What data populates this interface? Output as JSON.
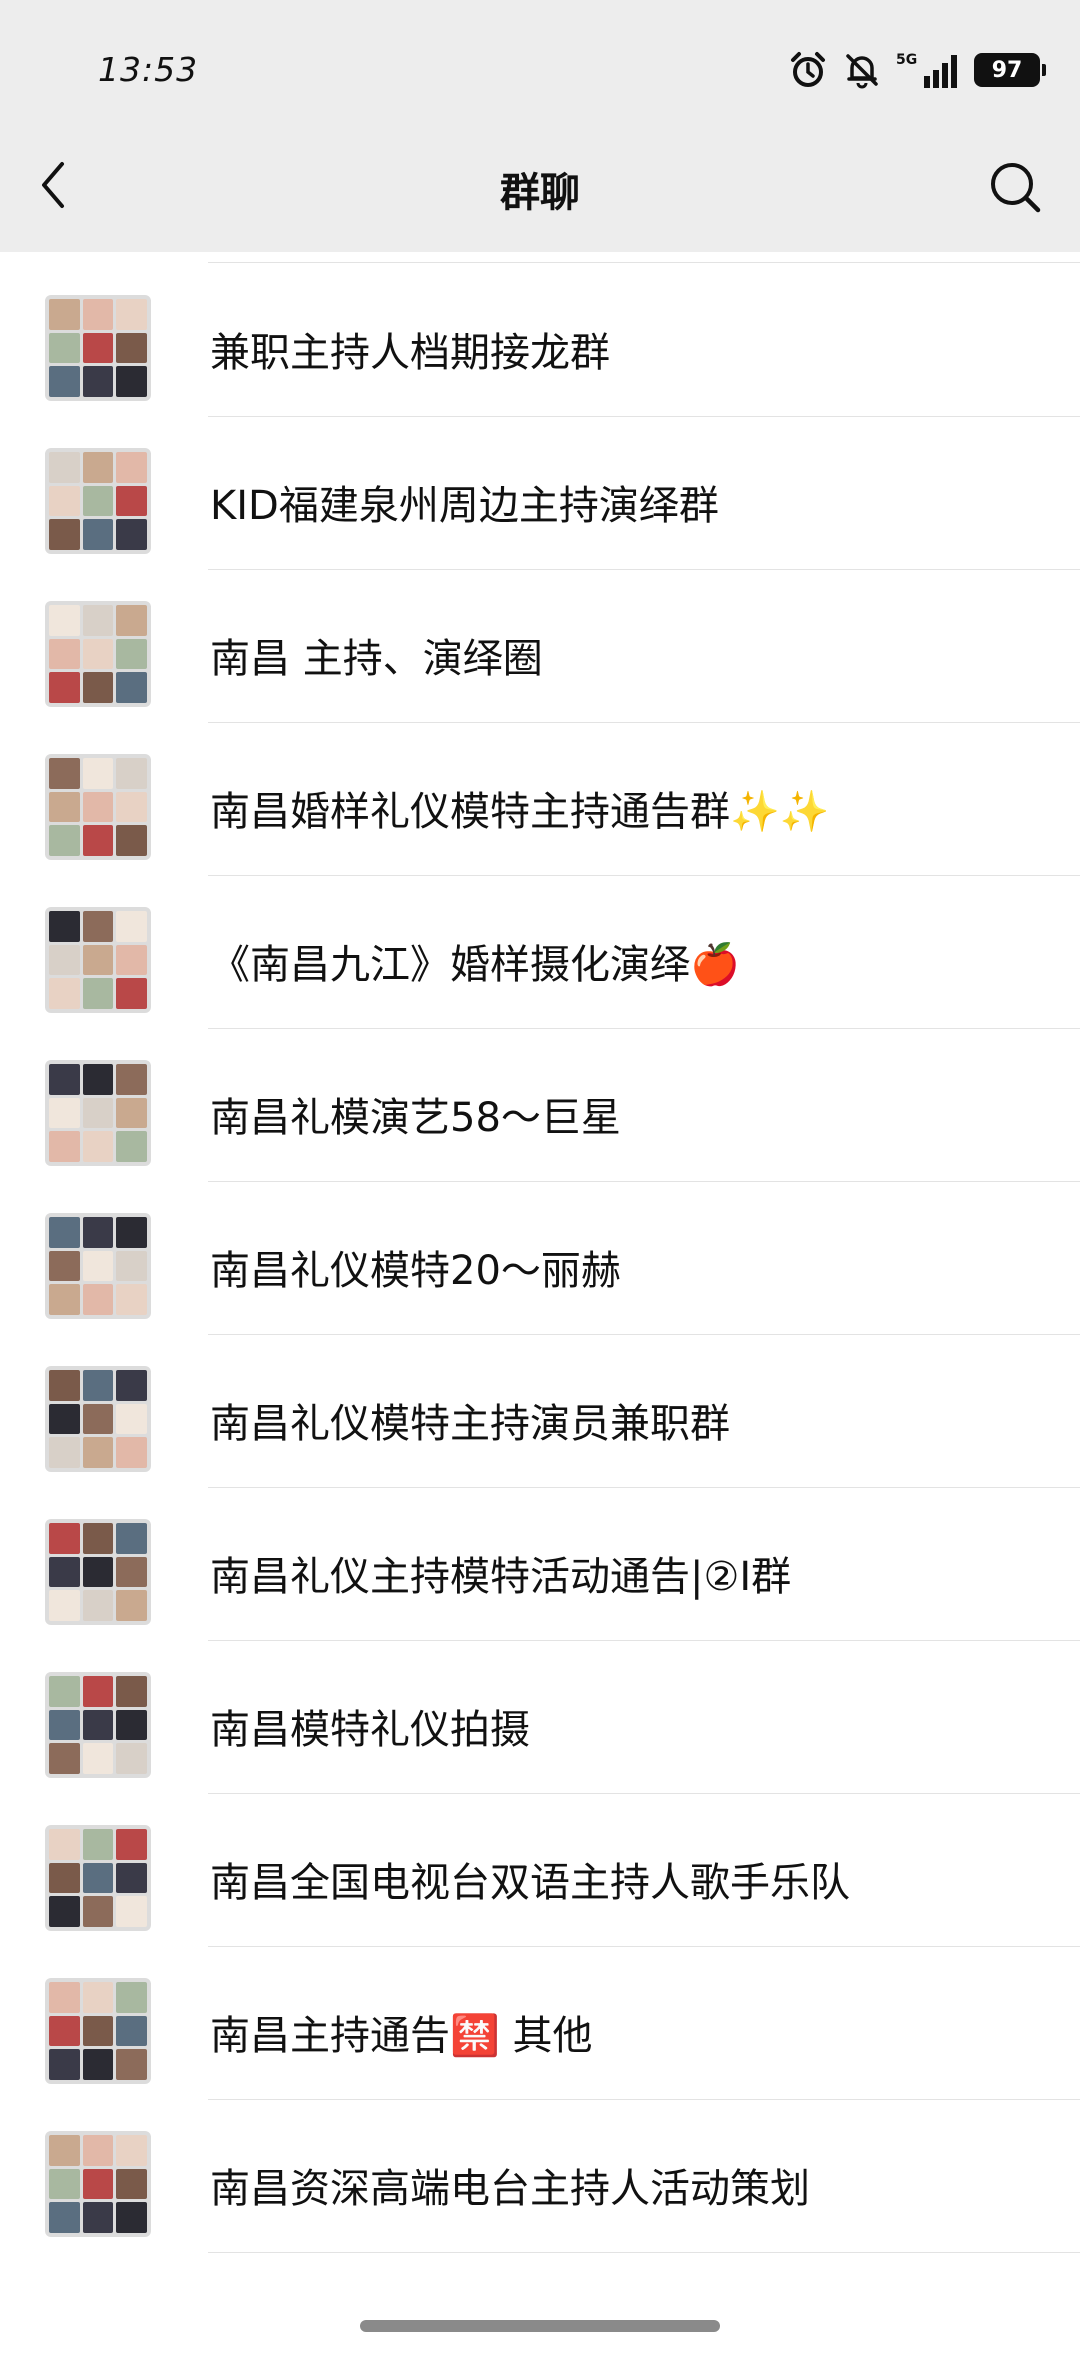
{
  "status_bar": {
    "time": "13:53",
    "network": "5G",
    "battery": "97",
    "icons": [
      "alarm-icon",
      "bell-muted-icon",
      "signal-icon",
      "battery-icon"
    ]
  },
  "header": {
    "title": "群聊",
    "back_icon": "chevron-left-icon",
    "search_icon": "search-icon"
  },
  "groups": [
    {
      "name": "兼职主持人档期接龙群"
    },
    {
      "name": "KID福建泉州周边主持演绎群"
    },
    {
      "name": "南昌 主持、演绎圈"
    },
    {
      "name": "南昌婚样礼仪模特主持通告群✨✨"
    },
    {
      "name": "《南昌九江》婚样摄化演绎🍎"
    },
    {
      "name": "南昌礼模演艺58～巨星"
    },
    {
      "name": "南昌礼仪模特20～丽赫"
    },
    {
      "name": "南昌礼仪模特主持演员兼职群"
    },
    {
      "name": "南昌礼仪主持模特活动通告|②I群"
    },
    {
      "name": "南昌模特礼仪拍摄"
    },
    {
      "name": "南昌全国电视台双语主持人歌手乐队"
    },
    {
      "name": "南昌主持通告🈲 其他"
    },
    {
      "name": "南昌资深高端电台主持人活动策划"
    }
  ]
}
